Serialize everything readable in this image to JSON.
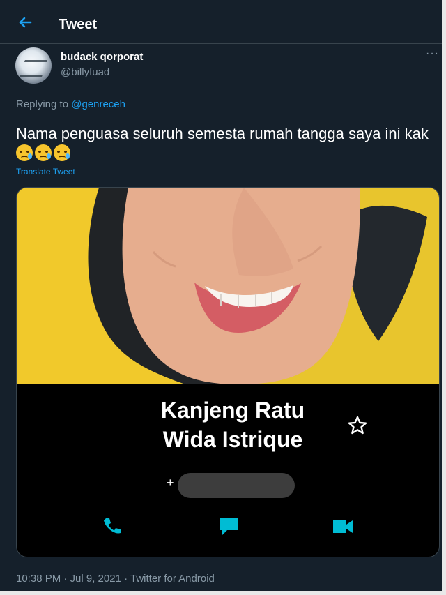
{
  "header": {
    "title": "Tweet",
    "back_icon": "arrow-left-icon"
  },
  "author": {
    "name": "budack qorporat",
    "handle": "@billyfuad",
    "avatar_icon": "profile-avatar",
    "more_icon": "more-horizontal-icon",
    "more_label": "···"
  },
  "reply": {
    "prefix": "Replying to ",
    "target": "@genreceh"
  },
  "tweet": {
    "text": "Nama penguasa seluruh semesta rumah tangga saya ini kak",
    "emojis": [
      "crying-face",
      "crying-face",
      "crying-face"
    ],
    "translate_label": "Translate Tweet"
  },
  "media": {
    "contact_name_line1": "Kanjeng Ratu",
    "contact_name_line2": "Wida Istrique",
    "phone_prefix": "+",
    "icons": [
      "star-outline-icon",
      "phone-icon",
      "message-icon",
      "video-icon"
    ]
  },
  "meta": {
    "timestamp": "10:38 PM · Jul 9, 2021 · Twitter for Android"
  },
  "colors": {
    "background": "#15202b",
    "accent": "#1da1f2",
    "muted": "#8899a6",
    "contact_action": "#00bcd4"
  }
}
